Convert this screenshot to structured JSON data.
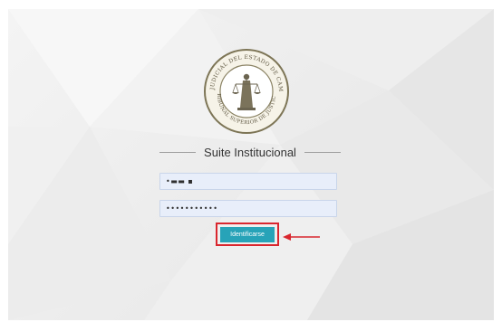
{
  "login": {
    "title": "Suite Institucional",
    "username_value": "•▬▬ ▪",
    "password_value": "•••••••••••",
    "submit_label": "Identificarse"
  },
  "seal": {
    "outer_text": "PODER JUDICIAL DEL ESTADO DE CAMPECHE",
    "inner_text": "TRIBUNAL SUPERIOR DE JUSTICIA"
  },
  "colors": {
    "button_bg": "#27a3b8",
    "highlight_border": "#d9262e",
    "annotation_arrow": "#d9262e",
    "input_bg": "#e8eefa"
  },
  "icons": {
    "seal": "tribunal-seal-icon",
    "arrow": "red-arrow-icon"
  }
}
